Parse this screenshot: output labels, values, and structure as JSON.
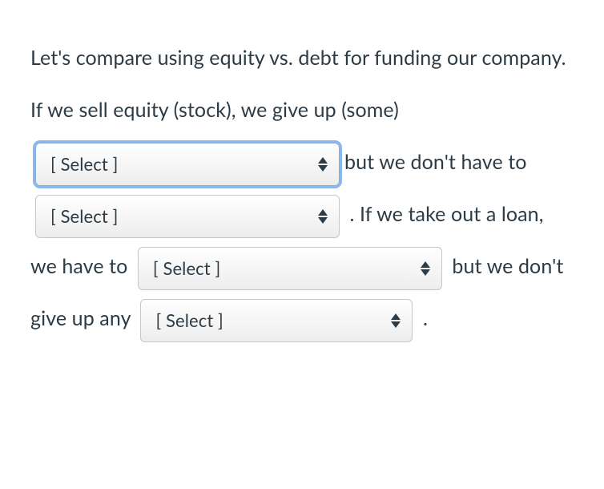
{
  "fragments": {
    "f0": "Let's compare using equity vs. debt for funding our company. If we sell equity (stock), we give up (some) ",
    "f1": "but we don't have to ",
    "f2": " . If we take out a loan, we have to ",
    "f3": " but we don't give up any ",
    "f4": " ."
  },
  "selects": {
    "s1": {
      "value": "[ Select ]",
      "focused": true
    },
    "s2": {
      "value": "[ Select ]",
      "focused": false
    },
    "s3": {
      "value": "[ Select ]",
      "focused": false
    },
    "s4": {
      "value": "[ Select ]",
      "focused": false
    }
  }
}
